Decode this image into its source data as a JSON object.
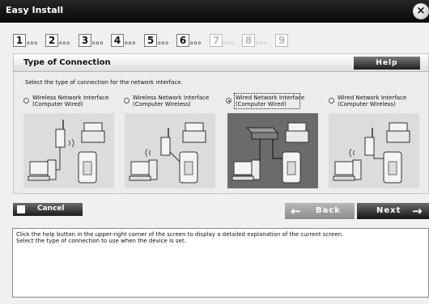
{
  "window": {
    "title": "Easy Install",
    "close_label": "×"
  },
  "steps": [
    {
      "num": "1",
      "dots": "ooo",
      "enabled": true
    },
    {
      "num": "2",
      "dots": "ooo",
      "enabled": true
    },
    {
      "num": "3",
      "dots": "ooo",
      "enabled": true
    },
    {
      "num": "4",
      "dots": "ooo",
      "enabled": true
    },
    {
      "num": "5",
      "dots": "ooo",
      "enabled": true
    },
    {
      "num": "6",
      "dots": "ooo",
      "enabled": true
    },
    {
      "num": "7",
      "dots": "ooo",
      "enabled": false
    },
    {
      "num": "8",
      "dots": "ooo",
      "enabled": false
    },
    {
      "num": "9",
      "dots": "",
      "enabled": false
    }
  ],
  "panel": {
    "title": "Type of Connection",
    "help_label": "Help",
    "instruction": "Select the type of connection for the network interface."
  },
  "options": [
    {
      "line1": "Wireless Network Interface",
      "line2": "(Computer Wired)",
      "selected": false
    },
    {
      "line1": "Wireless Network Interface",
      "line2": "(Computer Wireless)",
      "selected": false
    },
    {
      "line1": "Wired Network Interface",
      "line2": "(Computer Wired)",
      "selected": true
    },
    {
      "line1": "Wired Network Interface",
      "line2": "(Computer Wireless)",
      "selected": false
    }
  ],
  "buttons": {
    "cancel": "Cancel",
    "back": "Back",
    "next": "Next"
  },
  "icons": {
    "back": "←",
    "next": "→"
  },
  "help_text": {
    "line1": "Click the help button in the upper-right corner of the screen to display a detailed explanation of the current screen.",
    "line2": "Select the type of connection to use when the device is set."
  },
  "colors": {
    "titlebar": "#111111",
    "selected_bg": "#6b6b6b",
    "button_dark": "#1c1c1c"
  }
}
